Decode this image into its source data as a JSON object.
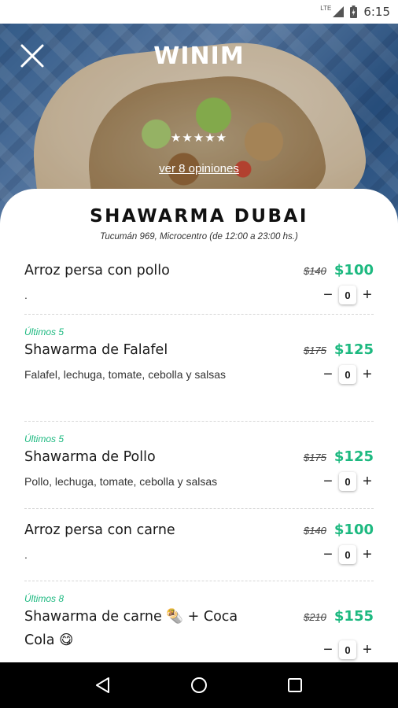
{
  "status_bar": {
    "network": "LTE",
    "time": "6:15"
  },
  "header": {
    "logo": "WINIM",
    "rating_stars": "★★★★★",
    "reviews_link": "ver 8 opiniones"
  },
  "restaurant": {
    "name": "SHAWARMA DUBAI",
    "address": "Tucumán 969, Microcentro (de 12:00 a 23:00 hs.)"
  },
  "menu": [
    {
      "tag": "",
      "name": "Arroz persa con pollo",
      "old_price": "$140",
      "price": "$100",
      "description": ".",
      "quantity": "0"
    },
    {
      "tag": "Últimos 5",
      "name": "Shawarma de Falafel",
      "old_price": "$175",
      "price": "$125",
      "description": "Falafel, lechuga, tomate, cebolla y salsas",
      "quantity": "0"
    },
    {
      "tag": "Últimos 5",
      "name": "Shawarma de Pollo",
      "old_price": "$175",
      "price": "$125",
      "description": "Pollo, lechuga, tomate, cebolla y salsas",
      "quantity": "0"
    },
    {
      "tag": "",
      "name": "Arroz persa con carne",
      "old_price": "$140",
      "price": "$100",
      "description": ".",
      "quantity": "0"
    },
    {
      "tag": "Últimos 8",
      "name": "Shawarma de carne 🌯 + Coca Cola 😋",
      "old_price": "$210",
      "price": "$155",
      "description": "",
      "quantity": "0"
    }
  ],
  "stepper": {
    "minus": "−",
    "plus": "+"
  },
  "icons": {
    "close": "close-icon",
    "back": "back-icon",
    "home": "home-icon",
    "recents": "recents-icon"
  },
  "colors": {
    "accent": "#1db980"
  }
}
